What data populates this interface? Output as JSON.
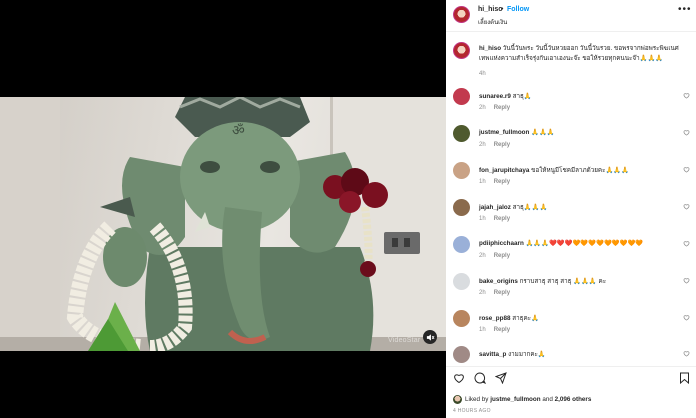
{
  "colors": {
    "link_blue": "#0095f6",
    "muted_gray": "#8e8e8e",
    "text": "#262626"
  },
  "post": {
    "username": "hi_hiso",
    "separator": "•",
    "follow_label": "Follow",
    "subtitle": "เลี้ยงต้นเงิน",
    "more_icon": "more-horizontal-icon",
    "watermark": "VideoStar",
    "mute_icon": "volume-muted-icon"
  },
  "caption": {
    "username": "hi_hiso",
    "text": "วันนี้วันพระ วันนี้วันหวยออก วันนี้วันรวย. ขอพรจากพ่อพระพิฆเนศ เทพแห่งความสำเร็จรุ่งกันเอาเองนะจ๊ะ ขอให้รวยทุกคนนะจ๊า🙏🙏🙏",
    "time": "4h"
  },
  "comments": [
    {
      "user": "sunaree.r9",
      "text": "สาธุ🙏",
      "time": "2h",
      "reply": "Reply",
      "avatar_color": "#c23a4e"
    },
    {
      "user": "justme_fullmoon",
      "text": "🙏🙏🙏",
      "time": "2h",
      "reply": "Reply",
      "avatar_color": "#4f5a2e"
    },
    {
      "user": "fon_jarupitchaya",
      "text": "ขอให้หนูมีโชคมีลาภด้วยคะ🙏🙏🙏",
      "time": "1h",
      "reply": "Reply",
      "avatar_color": "#c9a285"
    },
    {
      "user": "jajah_jaloz",
      "text": "สาธุ🙏🙏🙏",
      "time": "1h",
      "reply": "Reply",
      "avatar_color": "#8a6a4c"
    },
    {
      "user": "pdiiphicchaarn",
      "text": "🙏🙏🙏❤️❤️❤️🧡🧡🧡🧡🧡🧡🧡🧡🧡",
      "time": "2h",
      "reply": "Reply",
      "avatar_color": "#9ab0d8"
    },
    {
      "user": "bake_origins",
      "text": "กราบสาธุ สาธุ สาธุ 🙏🙏🙏 คะ",
      "time": "2h",
      "reply": "Reply",
      "avatar_color": "#d9dcdf"
    },
    {
      "user": "rose_pp88",
      "text": "สาธุคะ🙏",
      "time": "1h",
      "reply": "Reply",
      "avatar_color": "#b8855e"
    },
    {
      "user": "savitta_p",
      "text": "งามมากคะ🙏",
      "time": "",
      "reply": "",
      "avatar_color": "#a08a86"
    }
  ],
  "actions": {
    "like_icon": "heart-icon",
    "comment_icon": "comment-icon",
    "share_icon": "share-icon",
    "save_icon": "bookmark-icon"
  },
  "likes": {
    "prefix": "Liked by",
    "user": "justme_fullmoon",
    "and": "and",
    "others": "2,096 others"
  },
  "date": "4 HOURS AGO"
}
